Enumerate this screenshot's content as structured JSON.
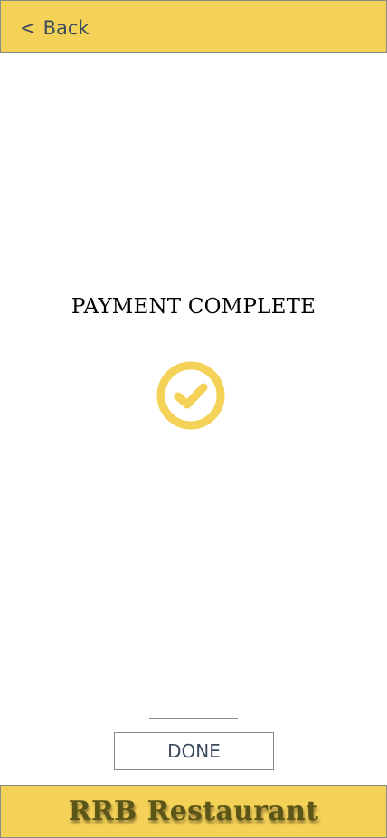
{
  "header": {
    "back_chevron": "<",
    "back_label": "Back"
  },
  "main": {
    "title": "PAYMENT COMPLETE",
    "status_icon": "check-circle-icon"
  },
  "actions": {
    "done_label": "DONE"
  },
  "footer": {
    "brand_name": "RRB Restaurant"
  },
  "colors": {
    "accent": "#f4d157",
    "text_dark": "#3b4a5e",
    "brand_text": "#5c5518"
  }
}
